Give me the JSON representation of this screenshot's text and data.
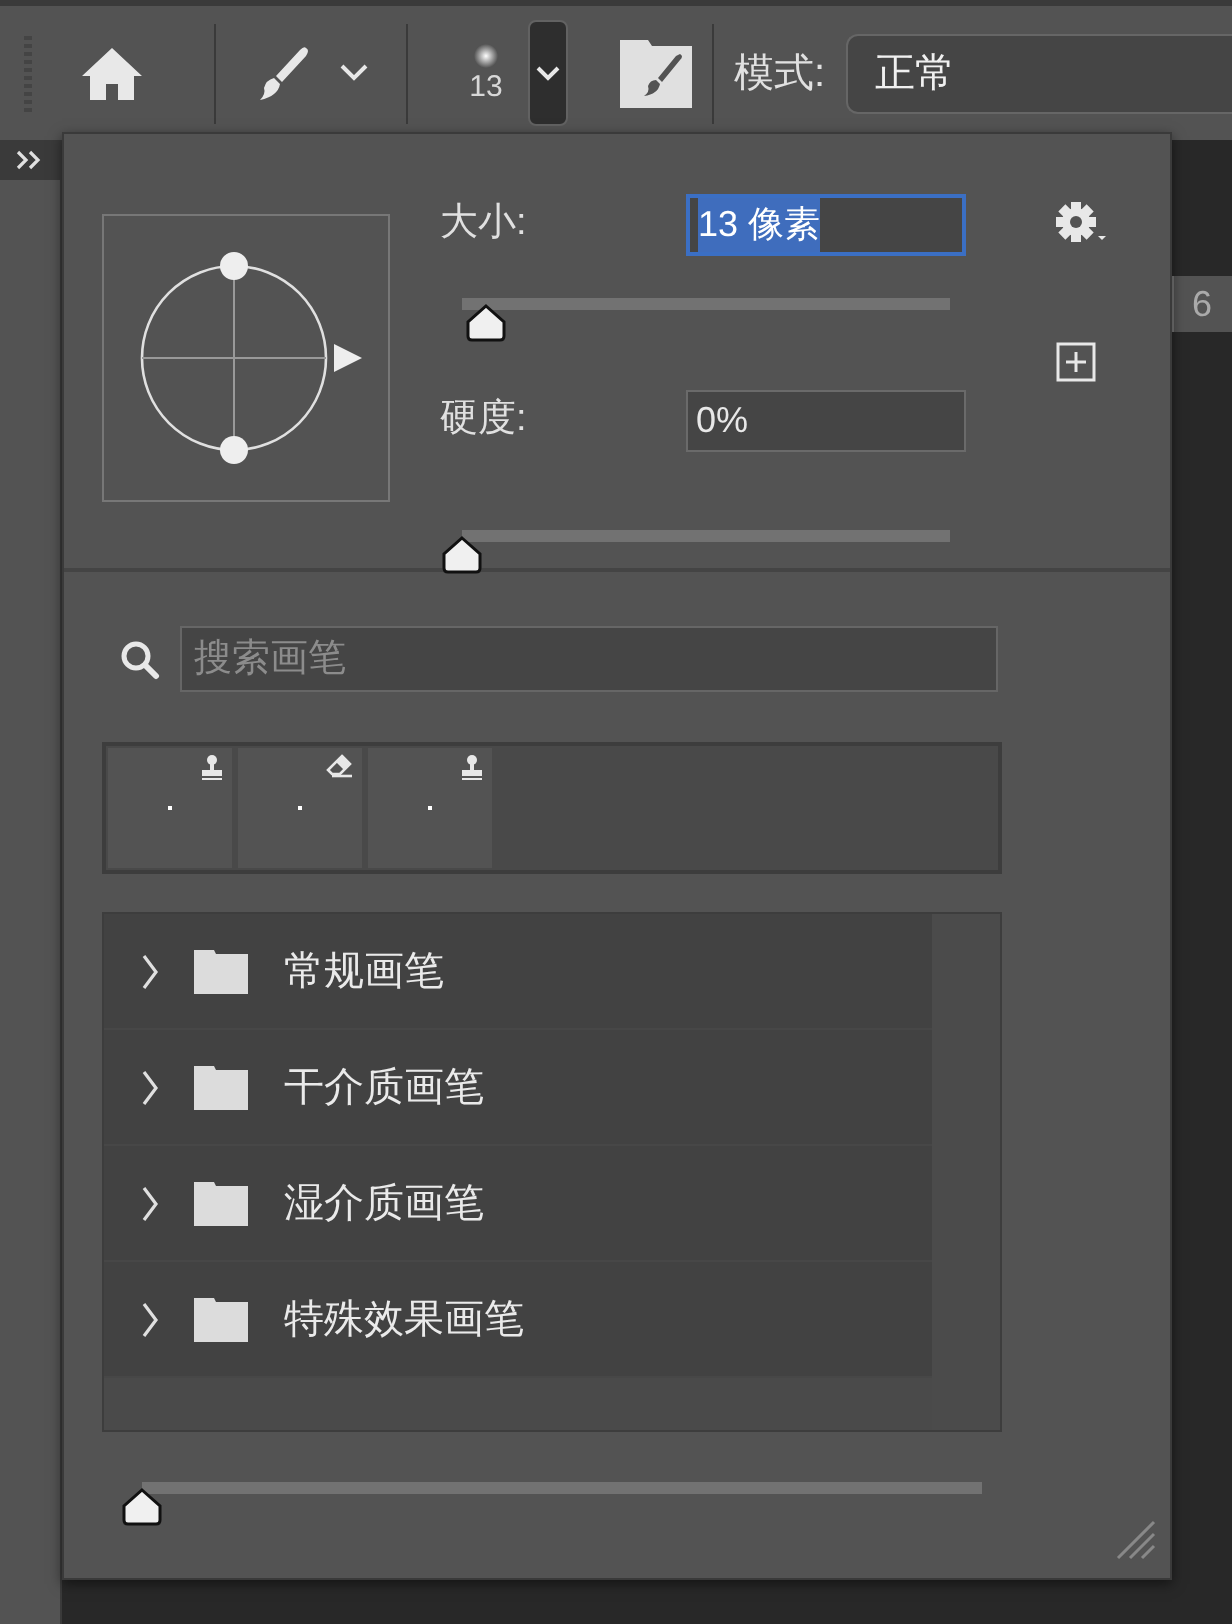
{
  "toolbar": {
    "brush_size": "13",
    "mode_label": "模式:",
    "mode_value": "正常"
  },
  "ruler": {
    "label": "6"
  },
  "brush_panel": {
    "size": {
      "label": "大小:",
      "value": "13 像素",
      "text_selected": true,
      "level": 0.05
    },
    "hardness": {
      "label": "硬度:",
      "value": "0%",
      "text_selected": false,
      "level": 0
    },
    "search": {
      "placeholder": "搜索画笔"
    },
    "presets": [
      {
        "kind": "stamp"
      },
      {
        "kind": "eraser"
      },
      {
        "kind": "stamp"
      }
    ],
    "folders": [
      {
        "name": "常规画笔",
        "expanded": false
      },
      {
        "name": "干介质画笔",
        "expanded": false
      },
      {
        "name": "湿介质画笔",
        "expanded": false
      },
      {
        "name": "特殊效果画笔",
        "expanded": false
      }
    ],
    "preview_size": {
      "level": 0
    }
  }
}
